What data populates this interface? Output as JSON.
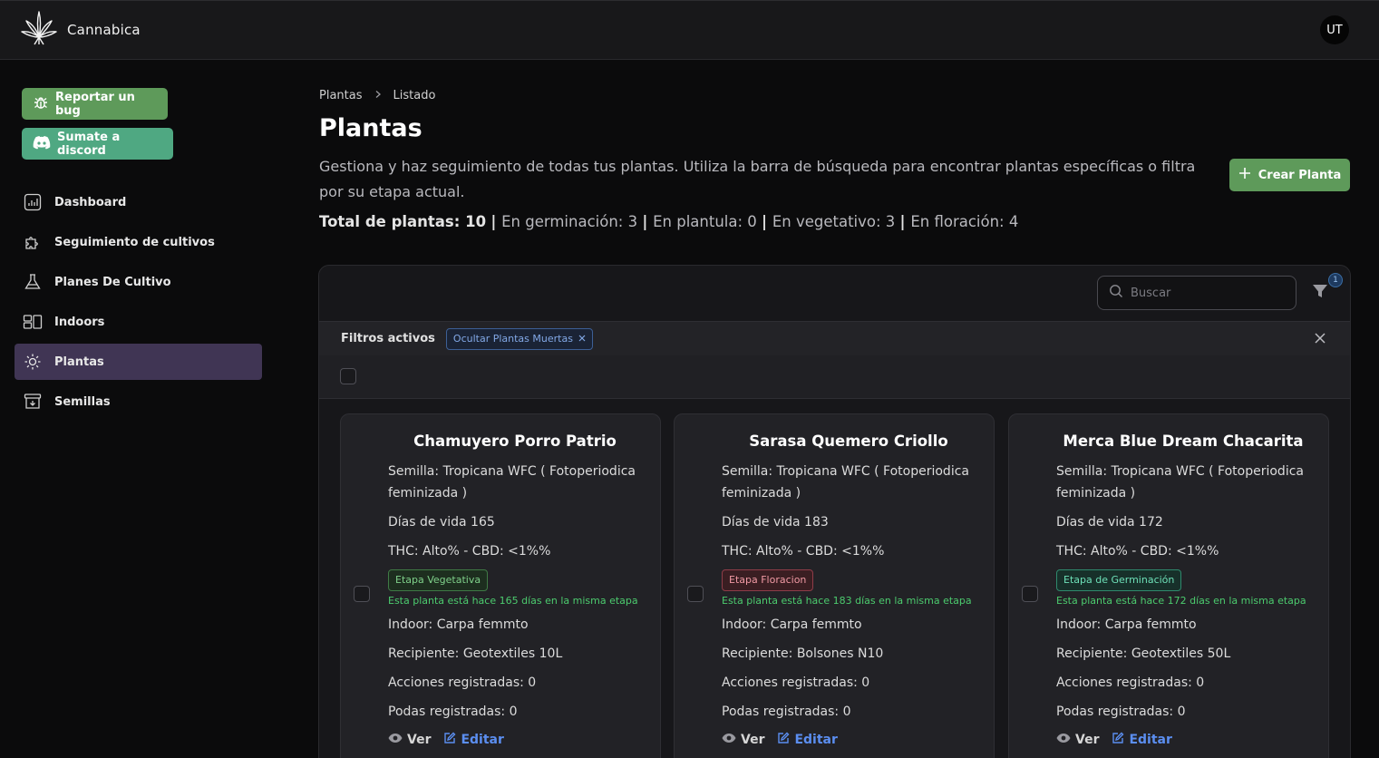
{
  "app": {
    "name": "Cannabica",
    "logo_icon": "cannabis-leaf-icon",
    "user_initials": "UT"
  },
  "sidebar": {
    "report_bug_label": "Reportar un bug",
    "discord_label": "Sumate a discord",
    "items": [
      {
        "label": "Dashboard",
        "icon": "chart-icon",
        "active": false
      },
      {
        "label": "Seguimiento de cultivos",
        "icon": "puzzle-icon",
        "active": false
      },
      {
        "label": "Planes De Cultivo",
        "icon": "flask-icon",
        "active": false
      },
      {
        "label": "Indoors",
        "icon": "indoor-icon",
        "active": false
      },
      {
        "label": "Plantas",
        "icon": "sun-icon",
        "active": true
      },
      {
        "label": "Semillas",
        "icon": "archive-icon",
        "active": false
      }
    ]
  },
  "header": {
    "breadcrumb": [
      "Plantas",
      "Listado"
    ],
    "title": "Plantas",
    "description": "Gestiona y haz seguimiento de todas tus plantas. Utiliza la barra de búsqueda para encontrar plantas específicas o filtra por su etapa actual.",
    "create_label": "Crear Planta",
    "stats": {
      "total": "Total de plantas: 10",
      "germinacion": "En germinación: 3",
      "plantula": "En plantula: 0",
      "vegetativo": "En vegetativo: 3",
      "floracion": "En floración: 4"
    }
  },
  "toolbar": {
    "search_placeholder": "Buscar",
    "filter_count": "1"
  },
  "filters": {
    "label": "Filtros activos",
    "chips": [
      "Ocultar Plantas Muertas"
    ]
  },
  "cards": [
    {
      "name": "Chamuyero Porro Patrio",
      "seed": "Semilla: Tropicana WFC ( Fotoperiodica feminizada )",
      "days": "Días de vida 165",
      "thc": "THC: Alto% - CBD: <1%%",
      "stage": "Etapa Vegetativa",
      "stage_color": "#7fd08a",
      "stage_note": "Esta planta está hace 165 días en la misma etapa",
      "indoor": "Indoor: Carpa femmto",
      "container": "Recipiente: Geotextiles 10L",
      "actions": "Acciones registradas: 0",
      "prunes": "Podas registradas: 0",
      "view_label": "Ver",
      "edit_label": "Editar"
    },
    {
      "name": "Sarasa Quemero Criollo",
      "seed": "Semilla: Tropicana WFC ( Fotoperiodica feminizada )",
      "days": "Días de vida 183",
      "thc": "THC: Alto% - CBD: <1%%",
      "stage": "Etapa Floracion",
      "stage_color": "#f09aa4",
      "stage_note": "Esta planta está hace 183 días en la misma etapa",
      "indoor": "Indoor: Carpa femmto",
      "container": "Recipiente: Bolsones N10",
      "actions": "Acciones registradas: 0",
      "prunes": "Podas registradas: 0",
      "view_label": "Ver",
      "edit_label": "Editar"
    },
    {
      "name": "Merca Blue Dream Chacarita",
      "seed": "Semilla: Tropicana WFC ( Fotoperiodica feminizada )",
      "days": "Días de vida 172",
      "thc": "THC: Alto% - CBD: <1%%",
      "stage": "Etapa de Germinación",
      "stage_color": "#6ee0b8",
      "stage_note": "Esta planta está hace 172 días en la misma etapa",
      "indoor": "Indoor: Carpa femmto",
      "container": "Recipiente: Geotextiles 50L",
      "actions": "Acciones registradas: 0",
      "prunes": "Podas registradas: 0",
      "view_label": "Ver",
      "edit_label": "Editar"
    }
  ]
}
